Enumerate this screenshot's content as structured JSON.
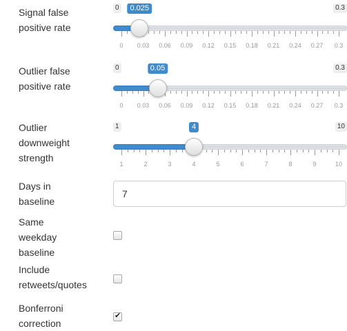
{
  "sliders": [
    {
      "label": "Signal false\npositive rate",
      "min_label": "0",
      "max_label": "0.3",
      "value_label": "0.025",
      "value": 0.025,
      "min": 0,
      "max": 0.3,
      "ticks": [
        "0",
        "0.03",
        "0.06",
        "0.09",
        "0.12",
        "0.15",
        "0.18",
        "0.21",
        "0.24",
        "0.27",
        "0.3"
      ]
    },
    {
      "label": "Outlier false\npositive rate",
      "min_label": "0",
      "max_label": "0.3",
      "value_label": "0.05",
      "value": 0.05,
      "min": 0,
      "max": 0.3,
      "ticks": [
        "0",
        "0.03",
        "0.06",
        "0.09",
        "0.12",
        "0.15",
        "0.18",
        "0.21",
        "0.24",
        "0.27",
        "0.3"
      ]
    },
    {
      "label": "Outlier\ndownweight\nstrength",
      "min_label": "1",
      "max_label": "10",
      "value_label": "4",
      "value": 4,
      "min": 1,
      "max": 10,
      "ticks": [
        "1",
        "2",
        "3",
        "4",
        "5",
        "6",
        "7",
        "8",
        "9",
        "10"
      ]
    }
  ],
  "baseline_days": {
    "label": "Days in\nbaseline",
    "value": "7"
  },
  "checkboxes": [
    {
      "label": "Same\nweekday\nbaseline",
      "checked": false
    },
    {
      "label": "Include\nretweets/quotes",
      "checked": false
    },
    {
      "label": "Bonferroni\ncorrection",
      "checked": true
    }
  ],
  "colors": {
    "accent": "#428bca",
    "track": "#e1e4e9",
    "text": "#333333"
  }
}
